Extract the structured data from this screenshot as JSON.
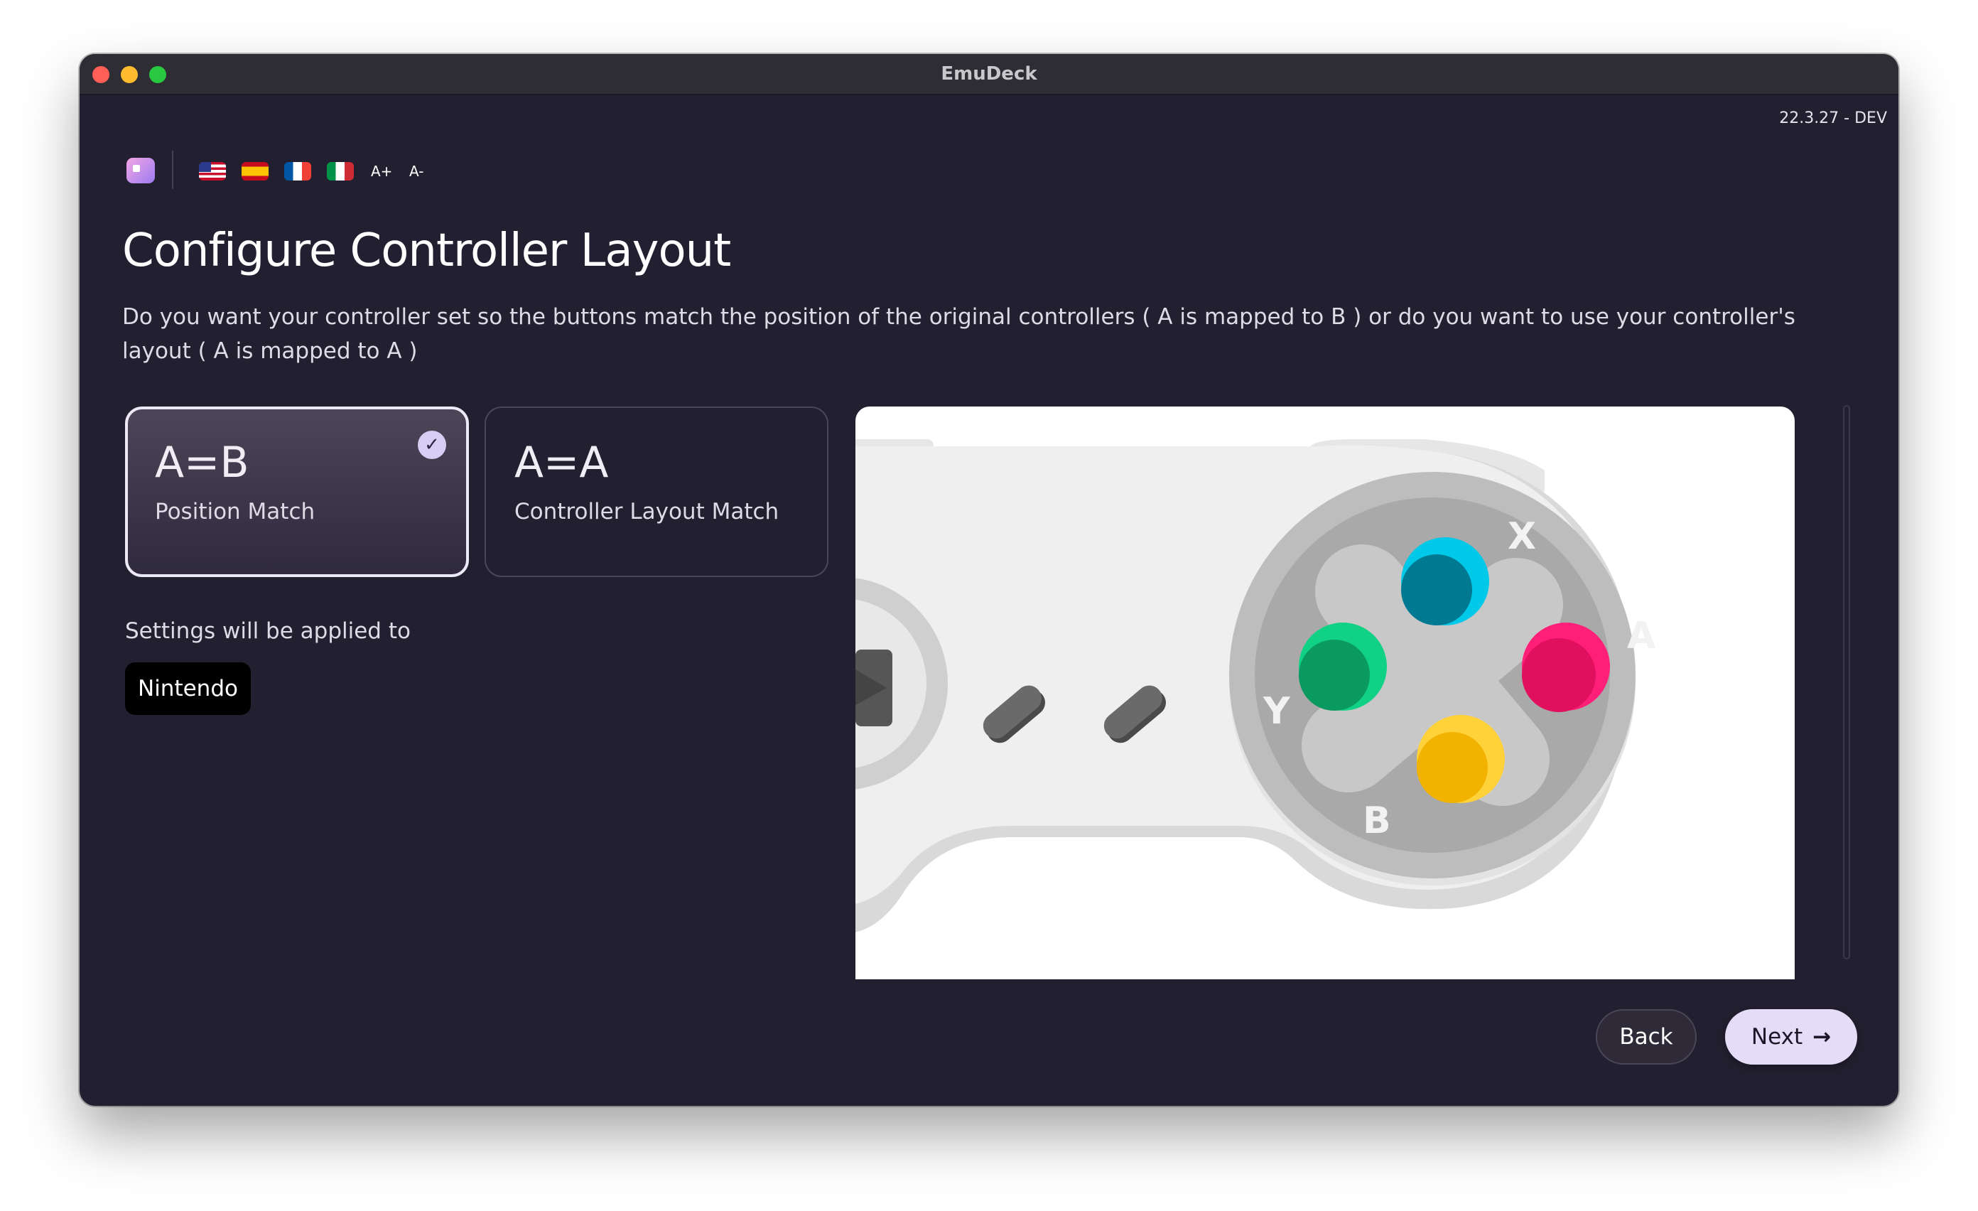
{
  "window": {
    "title": "EmuDeck",
    "version": "22.3.27 - DEV"
  },
  "toolbar": {
    "flags": [
      "flag-us-icon",
      "flag-es-icon",
      "flag-fr-icon",
      "flag-it-icon"
    ],
    "font_increase": "A+",
    "font_decrease": "A-"
  },
  "page": {
    "title": "Configure Controller Layout",
    "description": "Do you want your controller set so the buttons match the position of the original controllers ( A is mapped to B ) or do you want to use your controller's layout ( A is mapped to A )"
  },
  "options": [
    {
      "title": "A=B",
      "subtitle": "Position Match",
      "selected": true
    },
    {
      "title": "A=A",
      "subtitle": "Controller Layout Match",
      "selected": false
    }
  ],
  "applied": {
    "label": "Settings will be applied to",
    "system": "Nintendo"
  },
  "preview": {
    "button_labels": {
      "x": "X",
      "a": "A",
      "b": "B",
      "y": "Y"
    },
    "colors": {
      "x": "#00c8e8",
      "a": "#ff1f78",
      "b": "#ffc20e",
      "y": "#10d184"
    }
  },
  "nav": {
    "back": "Back",
    "next": "Next",
    "next_icon": "arrow-right-icon"
  },
  "colors": {
    "background": "#221f30",
    "accent": "#e5dcf7"
  }
}
